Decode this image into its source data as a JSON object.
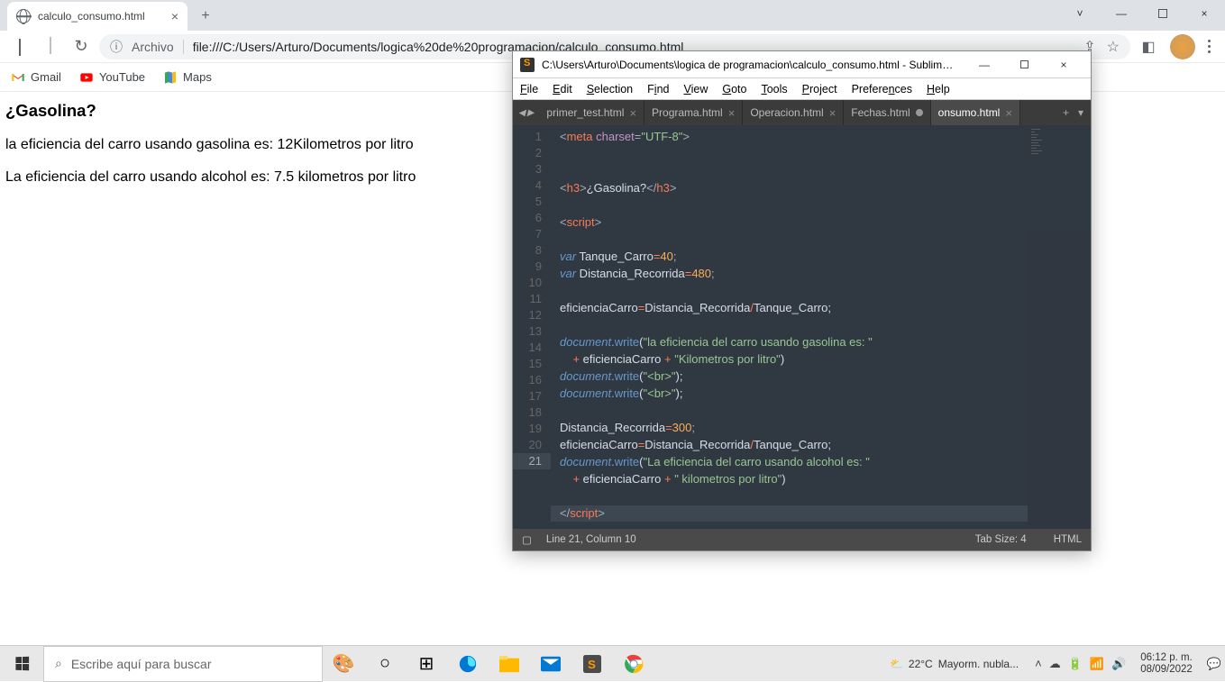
{
  "chrome": {
    "tab_title": "calculo_consumo.html",
    "omnibox": {
      "protocol_label": "Archivo",
      "url": "file:///C:/Users/Arturo/Documents/logica%20de%20programacion/calculo_consumo.html"
    },
    "bookmarks": [
      {
        "label": "Gmail"
      },
      {
        "label": "YouTube"
      },
      {
        "label": "Maps"
      }
    ]
  },
  "page": {
    "heading": "¿Gasolina?",
    "line1": "la eficiencia del carro usando gasolina es: 12Kilometros por litro",
    "line2": "La eficiencia del carro usando alcohol es: 7.5 kilometros por litro"
  },
  "sublime": {
    "title": "C:\\Users\\Arturo\\Documents\\logica de programacion\\calculo_consumo.html - Sublime ...",
    "menu": [
      "File",
      "Edit",
      "Selection",
      "Find",
      "View",
      "Goto",
      "Tools",
      "Project",
      "Preferences",
      "Help"
    ],
    "tabs": [
      {
        "label": "primer_test.html",
        "active": false,
        "dirty": false
      },
      {
        "label": "Programa.html",
        "active": false,
        "dirty": false
      },
      {
        "label": "Operacion.html",
        "active": false,
        "dirty": false
      },
      {
        "label": "Fechas.html",
        "active": false,
        "dirty": true
      },
      {
        "label": "onsumo.html",
        "active": true,
        "dirty": false
      }
    ],
    "status": {
      "pos": "Line 21, Column 10",
      "tabsize": "Tab Size: 4",
      "syntax": "HTML"
    },
    "code": {
      "l1": {
        "a": "<",
        "b": "meta",
        "c": " charset",
        "d": "=",
        "e": "\"UTF-8\"",
        "f": ">"
      },
      "l4": {
        "a": "<",
        "b": "h3",
        "c": ">",
        "d": "¿Gasolina?",
        "e": "</",
        "f": "h3",
        "g": ">"
      },
      "l6": {
        "a": "<",
        "b": "script",
        "c": ">"
      },
      "l8": {
        "a": "var",
        "b": " Tanque_Carro",
        "c": "=",
        "d": "40",
        "e": ";"
      },
      "l9": {
        "a": "var",
        "b": " Distancia_Recorrida",
        "c": "=",
        "d": "480",
        "e": ";"
      },
      "l11": {
        "a": "eficienciaCarro",
        "b": "=",
        "c": "Distancia_Recorrida",
        "d": "/",
        "e": "Tanque_Carro;"
      },
      "l13": {
        "a": "document",
        "b": ".",
        "c": "write",
        "d": "(",
        "e": "\"la eficiencia del carro usando gasolina es: \""
      },
      "l13b": {
        "a": "    ",
        "b": "+",
        "c": " eficienciaCarro ",
        "d": "+",
        "e": " ",
        "f": "\"Kilometros por litro\"",
        "g": ")"
      },
      "l14": {
        "a": "document",
        "b": ".",
        "c": "write",
        "d": "(",
        "e": "\"<br>\"",
        "f": ");"
      },
      "l15": {
        "a": "document",
        "b": ".",
        "c": "write",
        "d": "(",
        "e": "\"<br>\"",
        "f": ");"
      },
      "l17": {
        "a": "Distancia_Recorrida",
        "b": "=",
        "c": "300",
        "d": ";"
      },
      "l18": {
        "a": "eficienciaCarro",
        "b": "=",
        "c": "Distancia_Recorrida",
        "d": "/",
        "e": "Tanque_Carro;"
      },
      "l19": {
        "a": "document",
        "b": ".",
        "c": "write",
        "d": "(",
        "e": "\"La eficiencia del carro usando alcohol es: \""
      },
      "l19b": {
        "a": "    ",
        "b": "+",
        "c": " eficienciaCarro ",
        "d": "+",
        "e": " ",
        "f": "\" kilometros por litro\"",
        "g": ")"
      },
      "l21": {
        "a": "</",
        "b": "script",
        "c": ">"
      }
    }
  },
  "taskbar": {
    "search_placeholder": "Escribe aquí para buscar",
    "weather": {
      "temp": "22°C",
      "cond": "Mayorm. nubla..."
    },
    "time": "06:12 p. m.",
    "date": "08/09/2022"
  }
}
